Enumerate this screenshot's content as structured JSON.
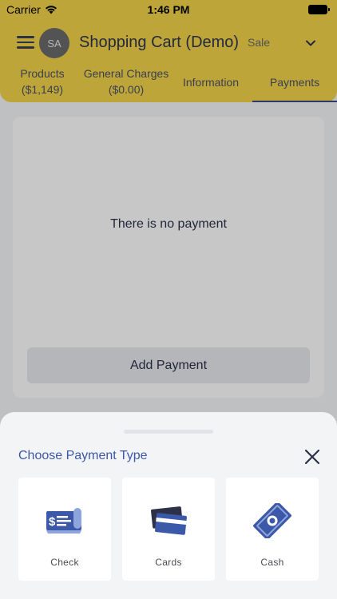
{
  "status_bar": {
    "carrier": "Carrier",
    "time": "1:46 PM"
  },
  "header": {
    "avatar_initials": "SA",
    "title": "Shopping Cart (Demo)",
    "mode": "Sale",
    "accent_color": "#f2d44a"
  },
  "tabs": [
    {
      "label": "Products",
      "sub": "($1,149)"
    },
    {
      "label": "General Charges",
      "sub": "($0.00)"
    },
    {
      "label": "Information"
    },
    {
      "label": "Payments",
      "selected": true
    }
  ],
  "payments": {
    "empty_message": "There is no payment",
    "add_button": "Add Payment"
  },
  "sheet": {
    "title": "Choose Payment Type",
    "options": [
      {
        "label": "Check",
        "icon": "check-icon"
      },
      {
        "label": "Cards",
        "icon": "cards-icon"
      },
      {
        "label": "Cash",
        "icon": "cash-icon"
      }
    ]
  }
}
